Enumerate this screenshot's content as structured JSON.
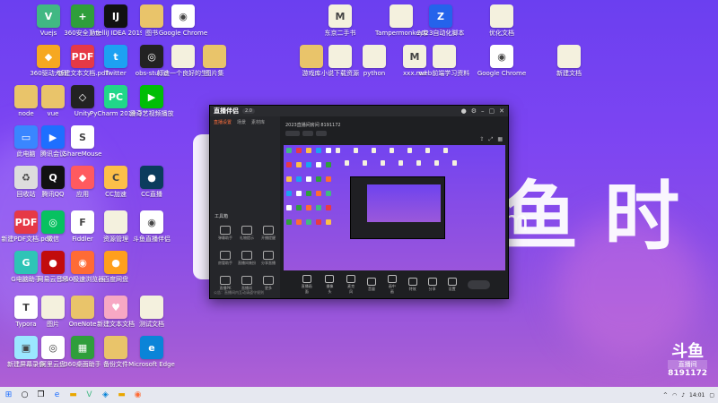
{
  "desktop": {
    "icons": [
      {
        "label": "Vuejs",
        "color": "#41b883",
        "glyph": "V",
        "icon": "vue-icon"
      },
      {
        "label": "360安全卫士",
        "color": "#2f9e3b",
        "glyph": "+",
        "icon": "shield-plus-icon"
      },
      {
        "label": "IntelliJ IDEA 2019.3.5",
        "color": "#111111",
        "glyph": "IJ",
        "icon": "intellij-icon"
      },
      {
        "label": "图书",
        "color": "#e9c46a",
        "glyph": "",
        "icon": "file-icon"
      },
      {
        "label": "Google Chrome",
        "color": "#ffffff",
        "glyph": "◉",
        "icon": "chrome-icon"
      },
      {
        "label": "东京二手书",
        "color": "#f4f1de",
        "glyph": "M",
        "icon": "markdown-file-icon"
      },
      {
        "label": "Tampermonkey新版本",
        "color": "#f4f1de",
        "glyph": "",
        "icon": "file-icon"
      },
      {
        "label": "2023自动化脚本",
        "color": "#2563eb",
        "glyph": "Z",
        "icon": "zip-icon"
      },
      {
        "label": "优化文档",
        "color": "#f4f1de",
        "glyph": "",
        "icon": "file-icon"
      },
      {
        "label": "360驱动大师",
        "color": "#f6a821",
        "glyph": "◆",
        "icon": "driver-icon"
      },
      {
        "label": "新建文本文档.pdf",
        "color": "#e63946",
        "glyph": "PDF",
        "icon": "pdf-icon"
      },
      {
        "label": "Twitter",
        "color": "#1da1f2",
        "glyph": "t",
        "icon": "twitter-icon"
      },
      {
        "label": "obs-studio",
        "color": "#222222",
        "glyph": "◎",
        "icon": "obs-icon"
      },
      {
        "label": "打造一个良好的生活习惯",
        "color": "#f4f1de",
        "glyph": "",
        "icon": "file-icon"
      },
      {
        "label": "图片集",
        "color": "#e9c46a",
        "glyph": "",
        "icon": "folder-icon"
      },
      {
        "label": "游戏库",
        "color": "#e9c46a",
        "glyph": "",
        "icon": "folder-icon"
      },
      {
        "label": "小说下载资源",
        "color": "#f4f1de",
        "glyph": "",
        "icon": "file-icon"
      },
      {
        "label": "python",
        "color": "#f4f1de",
        "glyph": "",
        "icon": "file-icon"
      },
      {
        "label": "xxx.md",
        "color": "#f4f1de",
        "glyph": "M",
        "icon": "markdown-file-icon"
      },
      {
        "label": "web前端学习资料",
        "color": "#f4f1de",
        "glyph": "",
        "icon": "file-icon"
      },
      {
        "label": "Google Chrome",
        "color": "#ffffff",
        "glyph": "◉",
        "icon": "chrome-icon"
      },
      {
        "label": "新建文档",
        "color": "#f4f1de",
        "glyph": "",
        "icon": "file-icon"
      },
      {
        "label": "node",
        "color": "#e9c46a",
        "glyph": "",
        "icon": "folder-icon"
      },
      {
        "label": "vue",
        "color": "#e9c46a",
        "glyph": "",
        "icon": "folder-icon"
      },
      {
        "label": "Unity",
        "color": "#222222",
        "glyph": "◇",
        "icon": "unity-icon"
      },
      {
        "label": "PyCharm 2019.3.5 x64",
        "color": "#21d789",
        "glyph": "PC",
        "icon": "pycharm-icon"
      },
      {
        "label": "爱奇艺视频播放",
        "color": "#00be06",
        "glyph": "▶",
        "icon": "video-icon"
      },
      {
        "label": "此电脑",
        "color": "#3a86ff",
        "glyph": "▭",
        "icon": "computer-icon"
      },
      {
        "label": "腾讯会议",
        "color": "#1e6fff",
        "glyph": "▶",
        "icon": "meeting-icon"
      },
      {
        "label": "ShareMouse",
        "color": "#ffffff",
        "glyph": "S",
        "icon": "sharemouse-icon"
      },
      {
        "label": "回收站",
        "color": "#dddddd",
        "glyph": "♻",
        "icon": "recycle-bin-icon"
      },
      {
        "label": "腾讯QQ",
        "color": "#111111",
        "glyph": "Q",
        "icon": "qq-icon"
      },
      {
        "label": "应用",
        "color": "#ff5a5f",
        "glyph": "◆",
        "icon": "app-icon"
      },
      {
        "label": "CC加速",
        "color": "#fcbf49",
        "glyph": "C",
        "icon": "accelerator-icon"
      },
      {
        "label": "CC直播",
        "color": "#0b3c5d",
        "glyph": "●",
        "icon": "live-icon"
      },
      {
        "label": "新建PDF文档.pdf",
        "color": "#e63946",
        "glyph": "PDF",
        "icon": "pdf-icon"
      },
      {
        "label": "微信",
        "color": "#07c160",
        "glyph": "◎",
        "icon": "wechat-icon"
      },
      {
        "label": "Fiddler",
        "color": "#ffffff",
        "glyph": "F",
        "icon": "fiddler-icon"
      },
      {
        "label": "资源管理",
        "color": "#f4f1de",
        "glyph": "",
        "icon": "file-icon"
      },
      {
        "label": "斗鱼直播伴侣",
        "color": "#ffffff",
        "glyph": "◉",
        "icon": "douyu-icon"
      },
      {
        "label": "G电脑助手",
        "color": "#2ec4b6",
        "glyph": "G",
        "icon": "assistant-icon"
      },
      {
        "label": "网易云音乐",
        "color": "#c20c0c",
        "glyph": "●",
        "icon": "music-icon"
      },
      {
        "label": "360极速浏览器",
        "color": "#ff6b35",
        "glyph": "◉",
        "icon": "browser-icon"
      },
      {
        "label": "百度网盘",
        "color": "#ff9f1c",
        "glyph": "●",
        "icon": "netdisk-icon"
      },
      {
        "label": "Typora",
        "color": "#ffffff",
        "glyph": "T",
        "icon": "typora-icon"
      },
      {
        "label": "图片",
        "color": "#f4f1de",
        "glyph": "",
        "icon": "file-icon"
      },
      {
        "label": "OneNote",
        "color": "#e9c46a",
        "glyph": "",
        "icon": "folder-icon"
      },
      {
        "label": "新建文本文档",
        "color": "#f7a8c4",
        "glyph": "♥",
        "icon": "note-icon"
      },
      {
        "label": "测试文档",
        "color": "#f4f1de",
        "glyph": "",
        "icon": "file-icon"
      },
      {
        "label": "新建屏幕录像",
        "color": "#9be7ff",
        "glyph": "▣",
        "icon": "recorder-icon"
      },
      {
        "label": "阿里云盘",
        "color": "#ffffff",
        "glyph": "◎",
        "icon": "cloud-icon"
      },
      {
        "label": "360桌面助手",
        "color": "#2f9e3b",
        "glyph": "▦",
        "icon": "desktop-assistant-icon"
      },
      {
        "label": "备份文件",
        "color": "#e9c46a",
        "glyph": "",
        "icon": "folder-icon"
      },
      {
        "label": "Microsoft Edge",
        "color": "#0a84d8",
        "glyph": "e",
        "icon": "edge-icon"
      }
    ]
  },
  "app": {
    "brand": "直播伴侣",
    "badge": "2.0",
    "left_tabs": [
      "直播设置",
      "场景",
      "素材库"
    ],
    "toolbox_title": "工具箱",
    "tools": [
      "弹幕助手",
      "礼物提示",
      "开播提醒",
      "房管助手",
      "直播间装扮",
      "分享直播",
      "直播PK",
      "直播间",
      "更多"
    ],
    "room_title": "2023直播间房间 8191172",
    "bottom_controls": [
      "直播画面",
      "摄像头",
      "麦克风",
      "音量",
      "画中画",
      "特效",
      "分享",
      "设置"
    ],
    "notice": "公告：直播间内互动请遵守规则"
  },
  "watermark": {
    "brand_text": "鱼 时",
    "sub_text": "m"
  },
  "douyu": {
    "logo": "斗鱼",
    "tag": "直播间",
    "room": "8191172"
  },
  "taskbar": {
    "time": "14:01",
    "search": "搜索"
  }
}
